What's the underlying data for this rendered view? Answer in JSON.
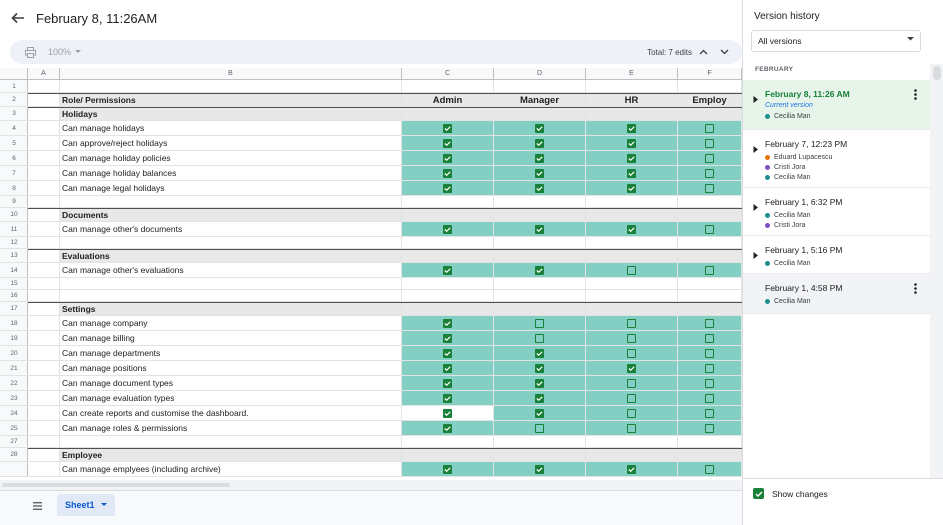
{
  "header": {
    "title": "February 8, 11:26AM"
  },
  "toolbar": {
    "zoom": "100%",
    "total_edits": "Total: 7 edits"
  },
  "columns": [
    "A",
    "B",
    "C",
    "D",
    "E",
    "F"
  ],
  "row_numbers": [
    "1",
    "2",
    "3",
    "4",
    "5",
    "6",
    "7",
    "8",
    "9",
    "10",
    "11",
    "12",
    "13",
    "14",
    "15",
    "16",
    "17",
    "18",
    "19",
    "20",
    "21",
    "22",
    "23",
    "24",
    "25",
    "27",
    "28"
  ],
  "table": {
    "header": {
      "role": "Role/ Permissions",
      "admin": "Admin",
      "manager": "Manager",
      "hr": "HR",
      "employee": "Employ"
    },
    "sections": {
      "holidays": "Holidays",
      "documents": "Documents",
      "evaluations": "Evaluations",
      "settings": "Settings",
      "employee": "Employee"
    },
    "rows": [
      {
        "label": "Can manage holidays",
        "checks": [
          true,
          true,
          true,
          false
        ]
      },
      {
        "label": "Can approve/reject holidays",
        "checks": [
          true,
          true,
          true,
          false
        ]
      },
      {
        "label": "Can manage holiday policies",
        "checks": [
          true,
          true,
          true,
          false
        ]
      },
      {
        "label": "Can manage holiday balances",
        "checks": [
          true,
          true,
          true,
          false
        ]
      },
      {
        "label": "Can manage legal holidays",
        "checks": [
          true,
          true,
          true,
          false
        ]
      },
      {
        "label": "Can manage other's documents",
        "checks": [
          true,
          true,
          true,
          false
        ]
      },
      {
        "label": "Can manage other's evaluations",
        "checks": [
          true,
          true,
          false,
          false
        ]
      },
      {
        "label": "Can manage company",
        "checks": [
          true,
          false,
          false,
          false
        ]
      },
      {
        "label": "Can manage billing",
        "checks": [
          true,
          false,
          false,
          false
        ]
      },
      {
        "label": "Can manage departments",
        "checks": [
          true,
          true,
          false,
          false
        ]
      },
      {
        "label": "Can manage positions",
        "checks": [
          true,
          true,
          true,
          false
        ]
      },
      {
        "label": "Can manage document types",
        "checks": [
          true,
          true,
          false,
          false
        ]
      },
      {
        "label": "Can manage evaluation types",
        "checks": [
          true,
          true,
          false,
          false
        ]
      },
      {
        "label": "Can create reports and customise the dashboard.",
        "checks": [
          true,
          true,
          false,
          false
        ]
      },
      {
        "label": "Can manage roles & permissions",
        "checks": [
          true,
          false,
          false,
          false
        ]
      },
      {
        "label": "Can manage emplyees (including archive)",
        "checks": [
          true,
          true,
          true,
          false
        ]
      }
    ]
  },
  "sheet": {
    "tab_label": "Sheet1"
  },
  "panel": {
    "title": "Version history",
    "filter": "All versions",
    "month": "FEBRUARY",
    "versions": [
      {
        "title": "February 8, 11:26 AM",
        "current": "Current version",
        "authors": [
          "Cecilia Man"
        ]
      },
      {
        "title": "February 7, 12:23 PM",
        "authors": [
          "Eduard Lupacescu",
          "Cristi Jora",
          "Cecilia Man"
        ]
      },
      {
        "title": "February 1, 6:32 PM",
        "authors": [
          "Cecilia Man",
          "Cristi Jora"
        ]
      },
      {
        "title": "February 1, 5:16 PM",
        "authors": [
          "Cecilia Man"
        ]
      },
      {
        "title": "February 1, 4:58 PM",
        "authors": [
          "Cecilia Man"
        ]
      }
    ],
    "show_changes": "Show changes"
  },
  "colors": {
    "teal": "#84cfc4",
    "green": "#188038",
    "author_teal": "#1e8e8e",
    "author_orange": "#e37400",
    "author_purple": "#7b4fc4"
  },
  "icons": [
    "back-arrow-icon",
    "print-icon",
    "chevron-up-icon",
    "chevron-down-icon",
    "all-sheets-icon",
    "more-vert-icon",
    "caret-right-icon"
  ]
}
